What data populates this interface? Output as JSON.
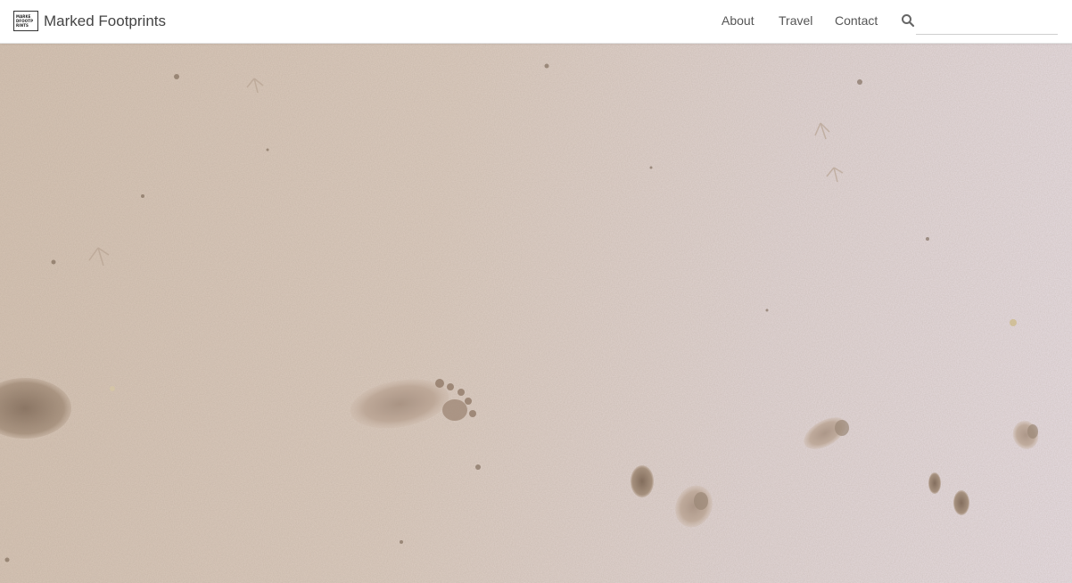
{
  "brand": {
    "logo_lines": [
      "MARKE",
      "DFOOTP",
      "RINTS"
    ],
    "name": "Marked Footprints"
  },
  "nav": {
    "items": [
      {
        "label": "About"
      },
      {
        "label": "Travel"
      },
      {
        "label": "Contact"
      }
    ]
  },
  "search": {
    "icon": "search-icon",
    "value": "",
    "placeholder": ""
  },
  "hero": {
    "image": "footprints-in-sand"
  }
}
